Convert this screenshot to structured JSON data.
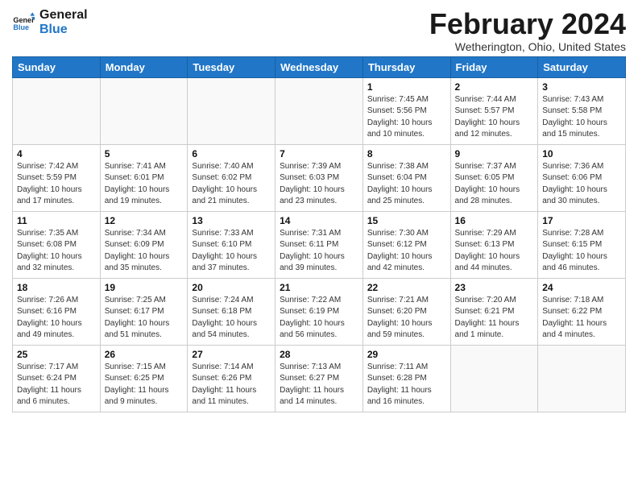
{
  "logo": {
    "line1": "General",
    "line2": "Blue"
  },
  "title": "February 2024",
  "location": "Wetherington, Ohio, United States",
  "days_of_week": [
    "Sunday",
    "Monday",
    "Tuesday",
    "Wednesday",
    "Thursday",
    "Friday",
    "Saturday"
  ],
  "weeks": [
    [
      {
        "day": "",
        "info": ""
      },
      {
        "day": "",
        "info": ""
      },
      {
        "day": "",
        "info": ""
      },
      {
        "day": "",
        "info": ""
      },
      {
        "day": "1",
        "info": "Sunrise: 7:45 AM\nSunset: 5:56 PM\nDaylight: 10 hours\nand 10 minutes."
      },
      {
        "day": "2",
        "info": "Sunrise: 7:44 AM\nSunset: 5:57 PM\nDaylight: 10 hours\nand 12 minutes."
      },
      {
        "day": "3",
        "info": "Sunrise: 7:43 AM\nSunset: 5:58 PM\nDaylight: 10 hours\nand 15 minutes."
      }
    ],
    [
      {
        "day": "4",
        "info": "Sunrise: 7:42 AM\nSunset: 5:59 PM\nDaylight: 10 hours\nand 17 minutes."
      },
      {
        "day": "5",
        "info": "Sunrise: 7:41 AM\nSunset: 6:01 PM\nDaylight: 10 hours\nand 19 minutes."
      },
      {
        "day": "6",
        "info": "Sunrise: 7:40 AM\nSunset: 6:02 PM\nDaylight: 10 hours\nand 21 minutes."
      },
      {
        "day": "7",
        "info": "Sunrise: 7:39 AM\nSunset: 6:03 PM\nDaylight: 10 hours\nand 23 minutes."
      },
      {
        "day": "8",
        "info": "Sunrise: 7:38 AM\nSunset: 6:04 PM\nDaylight: 10 hours\nand 25 minutes."
      },
      {
        "day": "9",
        "info": "Sunrise: 7:37 AM\nSunset: 6:05 PM\nDaylight: 10 hours\nand 28 minutes."
      },
      {
        "day": "10",
        "info": "Sunrise: 7:36 AM\nSunset: 6:06 PM\nDaylight: 10 hours\nand 30 minutes."
      }
    ],
    [
      {
        "day": "11",
        "info": "Sunrise: 7:35 AM\nSunset: 6:08 PM\nDaylight: 10 hours\nand 32 minutes."
      },
      {
        "day": "12",
        "info": "Sunrise: 7:34 AM\nSunset: 6:09 PM\nDaylight: 10 hours\nand 35 minutes."
      },
      {
        "day": "13",
        "info": "Sunrise: 7:33 AM\nSunset: 6:10 PM\nDaylight: 10 hours\nand 37 minutes."
      },
      {
        "day": "14",
        "info": "Sunrise: 7:31 AM\nSunset: 6:11 PM\nDaylight: 10 hours\nand 39 minutes."
      },
      {
        "day": "15",
        "info": "Sunrise: 7:30 AM\nSunset: 6:12 PM\nDaylight: 10 hours\nand 42 minutes."
      },
      {
        "day": "16",
        "info": "Sunrise: 7:29 AM\nSunset: 6:13 PM\nDaylight: 10 hours\nand 44 minutes."
      },
      {
        "day": "17",
        "info": "Sunrise: 7:28 AM\nSunset: 6:15 PM\nDaylight: 10 hours\nand 46 minutes."
      }
    ],
    [
      {
        "day": "18",
        "info": "Sunrise: 7:26 AM\nSunset: 6:16 PM\nDaylight: 10 hours\nand 49 minutes."
      },
      {
        "day": "19",
        "info": "Sunrise: 7:25 AM\nSunset: 6:17 PM\nDaylight: 10 hours\nand 51 minutes."
      },
      {
        "day": "20",
        "info": "Sunrise: 7:24 AM\nSunset: 6:18 PM\nDaylight: 10 hours\nand 54 minutes."
      },
      {
        "day": "21",
        "info": "Sunrise: 7:22 AM\nSunset: 6:19 PM\nDaylight: 10 hours\nand 56 minutes."
      },
      {
        "day": "22",
        "info": "Sunrise: 7:21 AM\nSunset: 6:20 PM\nDaylight: 10 hours\nand 59 minutes."
      },
      {
        "day": "23",
        "info": "Sunrise: 7:20 AM\nSunset: 6:21 PM\nDaylight: 11 hours\nand 1 minute."
      },
      {
        "day": "24",
        "info": "Sunrise: 7:18 AM\nSunset: 6:22 PM\nDaylight: 11 hours\nand 4 minutes."
      }
    ],
    [
      {
        "day": "25",
        "info": "Sunrise: 7:17 AM\nSunset: 6:24 PM\nDaylight: 11 hours\nand 6 minutes."
      },
      {
        "day": "26",
        "info": "Sunrise: 7:15 AM\nSunset: 6:25 PM\nDaylight: 11 hours\nand 9 minutes."
      },
      {
        "day": "27",
        "info": "Sunrise: 7:14 AM\nSunset: 6:26 PM\nDaylight: 11 hours\nand 11 minutes."
      },
      {
        "day": "28",
        "info": "Sunrise: 7:13 AM\nSunset: 6:27 PM\nDaylight: 11 hours\nand 14 minutes."
      },
      {
        "day": "29",
        "info": "Sunrise: 7:11 AM\nSunset: 6:28 PM\nDaylight: 11 hours\nand 16 minutes."
      },
      {
        "day": "",
        "info": ""
      },
      {
        "day": "",
        "info": ""
      }
    ]
  ]
}
